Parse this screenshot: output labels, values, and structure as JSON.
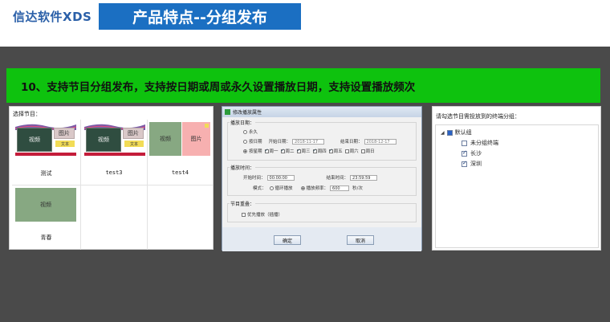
{
  "header": {
    "brand": "信达软件XDS",
    "title": "产品特点--分组发布"
  },
  "banner": {
    "text": "10、支持节目分组发布，支持按日期或周或永久设置播放日期，支持设置播放频次"
  },
  "program_panel": {
    "label": "选择节目：",
    "thumb_labels": {
      "video": "视频",
      "picture": "图片",
      "text": "文本"
    },
    "items": [
      {
        "name": "测试"
      },
      {
        "name": "test3"
      },
      {
        "name": "test4"
      },
      {
        "name": "青春"
      }
    ]
  },
  "dialog": {
    "title": "修改播放属性",
    "play_date_group": "播放日期：",
    "forever": "永久",
    "by_date": "按日期",
    "start_date_label": "开始日期：",
    "start_date": "2018-11-17",
    "end_date_label": "结束日期：",
    "end_date": "2018-12-17",
    "by_week": "按星期",
    "weekdays": [
      "周一",
      "周二",
      "周三",
      "周四",
      "周五",
      "周六",
      "周日"
    ],
    "weekdays_checked": [
      true,
      true,
      true,
      true,
      true,
      false,
      false
    ],
    "play_time_group": "播放时间：",
    "start_time_label": "开始时间：",
    "start_time": "00:00:00",
    "end_time_label": "结束时间：",
    "end_time": "23:59:59",
    "mode_label": "模式：",
    "mode_loop": "循环播放",
    "mode_freq": "播放频率：",
    "freq_value": "600",
    "freq_unit": "秒/次",
    "overlap_group": "节目重叠：",
    "priority": "优先播放（插播）",
    "ok": "确定",
    "cancel": "取消"
  },
  "group_panel": {
    "label": "请勾选节目需投放到的终端分组：",
    "root": "默认组",
    "children": [
      {
        "name": "未分组终端",
        "checked": false
      },
      {
        "name": "长沙",
        "checked": true
      },
      {
        "name": "深圳",
        "checked": true
      }
    ]
  },
  "colors": {
    "title_bg": "#1b6fc2",
    "banner_bg": "#0ec20e",
    "stage_bg": "#4a4a4a",
    "brand": "#2a5fa8"
  }
}
